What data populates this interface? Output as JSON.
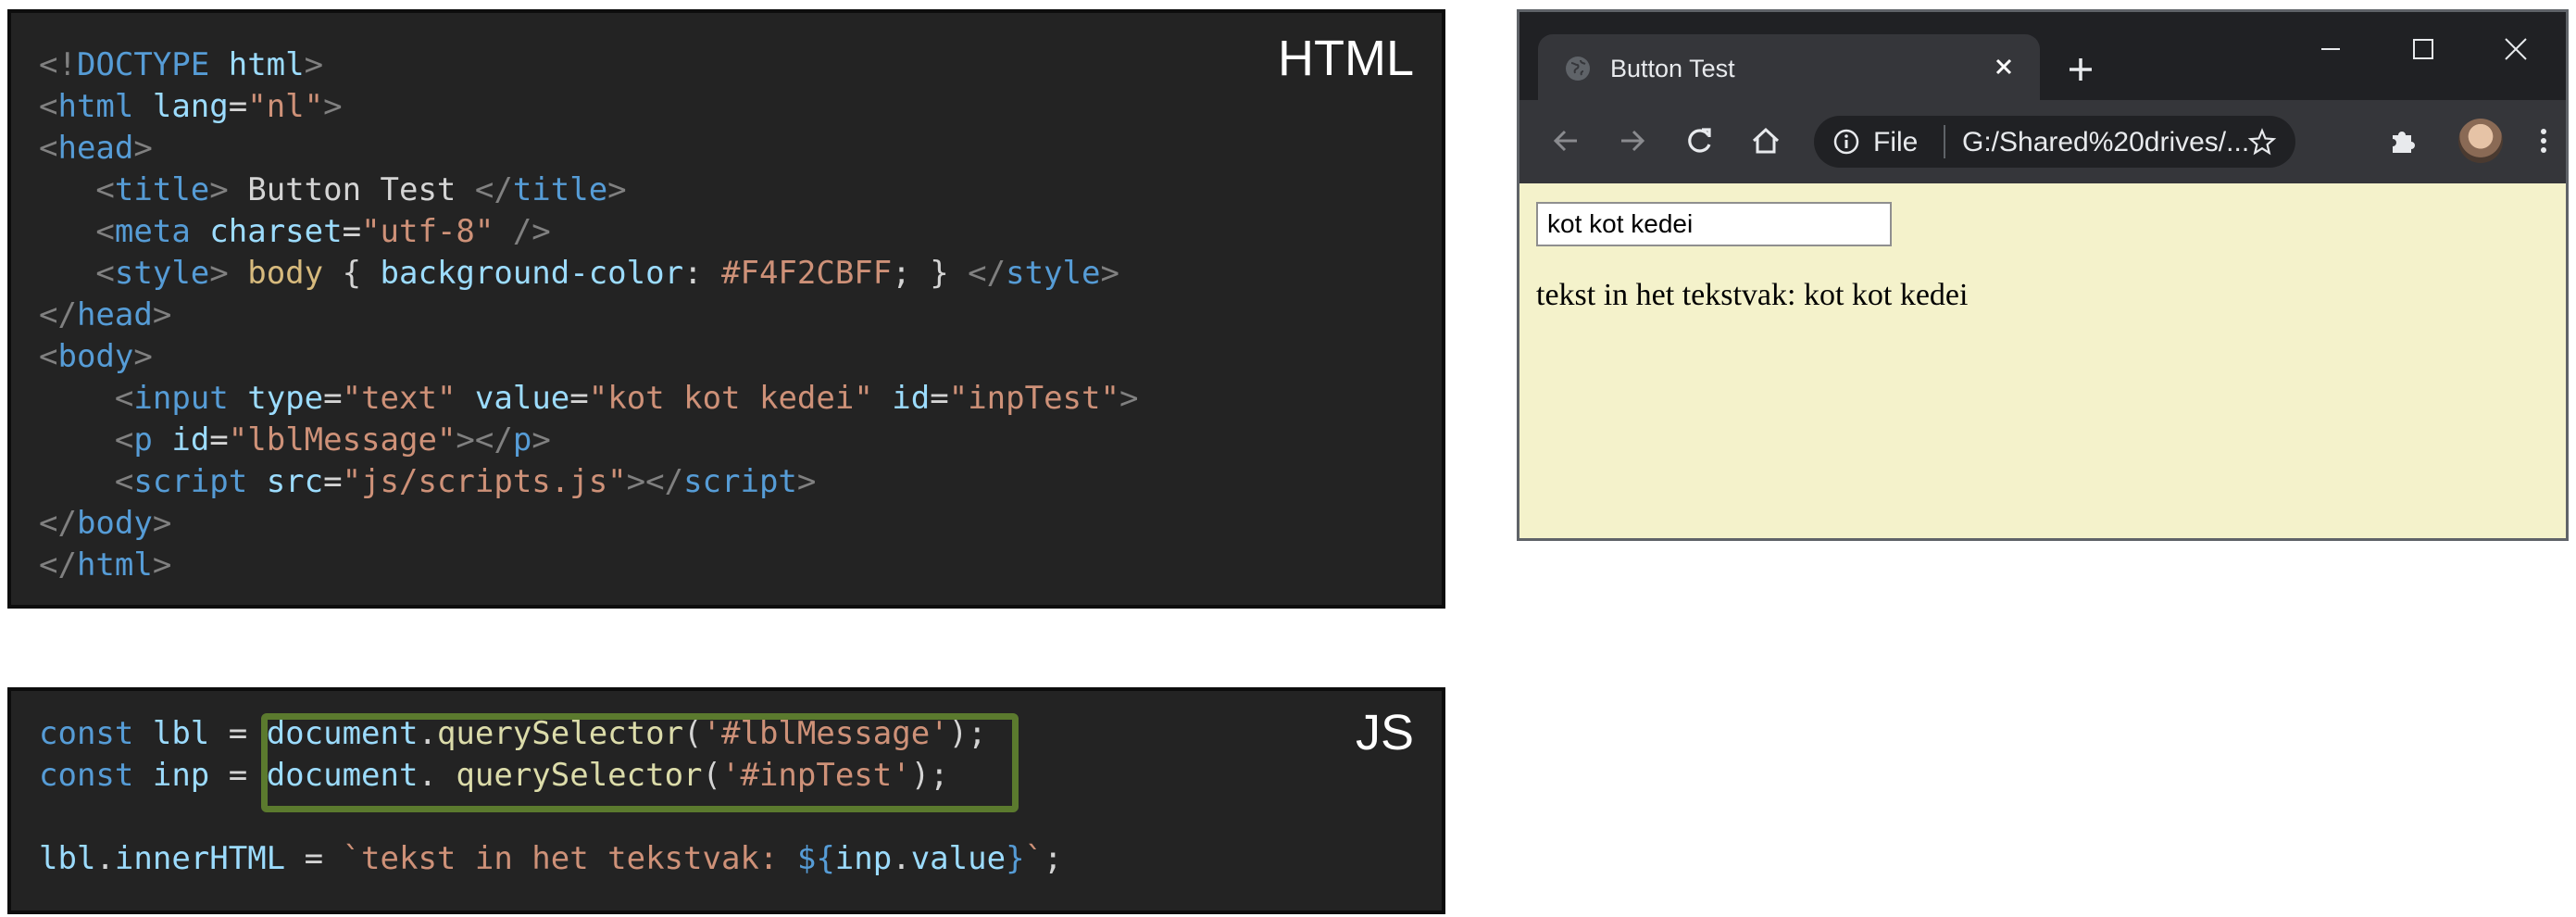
{
  "html_panel": {
    "label": "HTML",
    "lines": [
      [
        "<!",
        "DOCTYPE",
        " ",
        "html",
        ">"
      ],
      [
        "<",
        "html",
        " ",
        "lang",
        "=",
        "\"nl\"",
        ">"
      ],
      [
        "<",
        "head",
        ">"
      ],
      [
        "   ",
        "<",
        "title",
        ">",
        " Button Test ",
        "</",
        "title",
        ">"
      ],
      [
        "   ",
        "<",
        "meta",
        " ",
        "charset",
        "=",
        "\"utf-8\"",
        " />"
      ],
      [
        "   ",
        "<",
        "style",
        ">",
        " ",
        "body",
        " { ",
        "background-color",
        ": ",
        "#F4F2CBFF",
        "; } ",
        "</",
        "style",
        ">"
      ],
      [
        "</",
        "head",
        ">"
      ],
      [
        "<",
        "body",
        ">"
      ],
      [
        "    ",
        "<",
        "input",
        " ",
        "type",
        "=",
        "\"text\"",
        " ",
        "value",
        "=",
        "\"kot kot kedei\"",
        " ",
        "id",
        "=",
        "\"inpTest\"",
        ">"
      ],
      [
        "    ",
        "<",
        "p",
        " ",
        "id",
        "=",
        "\"lblMessage\"",
        "></",
        "p",
        ">"
      ],
      [
        "    ",
        "<",
        "script",
        " ",
        "src",
        "=",
        "\"js/scripts.js\"",
        "></",
        "script",
        ">"
      ],
      [
        "</",
        "body",
        ">"
      ],
      [
        "</",
        "html",
        ">"
      ]
    ],
    "classes": [
      [
        "punct",
        "tag",
        "txt",
        "attr",
        "punct"
      ],
      [
        "punct",
        "tag",
        "txt",
        "attr",
        "txt",
        "str",
        "punct"
      ],
      [
        "punct",
        "tag",
        "punct"
      ],
      [
        "txt",
        "punct",
        "tag",
        "punct",
        "txt",
        "punct",
        "tag",
        "punct"
      ],
      [
        "txt",
        "punct",
        "tag",
        "txt",
        "attr",
        "txt",
        "str",
        "punct"
      ],
      [
        "txt",
        "punct",
        "tag",
        "punct",
        "txt",
        "sel",
        "txt",
        "prop",
        "txt",
        "str",
        "txt",
        "punct",
        "tag",
        "punct"
      ],
      [
        "punct",
        "tag",
        "punct"
      ],
      [
        "punct",
        "tag",
        "punct"
      ],
      [
        "txt",
        "punct",
        "tag",
        "txt",
        "attr",
        "txt",
        "str",
        "txt",
        "attr",
        "txt",
        "str",
        "txt",
        "attr",
        "txt",
        "str",
        "punct"
      ],
      [
        "txt",
        "punct",
        "tag",
        "txt",
        "attr",
        "txt",
        "str",
        "punct",
        "tag",
        "punct"
      ],
      [
        "txt",
        "punct",
        "tag",
        "txt",
        "attr",
        "txt",
        "str",
        "punct",
        "tag",
        "punct"
      ],
      [
        "punct",
        "tag",
        "punct"
      ],
      [
        "punct",
        "tag",
        "punct"
      ]
    ]
  },
  "js_panel": {
    "label": "JS",
    "lines": [
      [
        "const",
        " ",
        "lbl",
        " = ",
        "document",
        ".",
        "querySelector",
        "(",
        "'#lblMessage'",
        ");"
      ],
      [
        "const",
        " ",
        "inp",
        " = ",
        "document",
        ". ",
        "querySelector",
        "(",
        "'#inpTest'",
        ");"
      ],
      [
        ""
      ],
      [
        "lbl",
        ".",
        "innerHTML",
        " = ",
        "`tekst in het tekstvak: ",
        "${",
        "inp",
        ".",
        "value",
        "}",
        "`",
        ";"
      ]
    ],
    "classes": [
      [
        "kw",
        "txt",
        "prop",
        "op",
        "prop",
        "op",
        "fn",
        "op",
        "str",
        "op"
      ],
      [
        "kw",
        "txt",
        "prop",
        "op",
        "prop",
        "op",
        "fn",
        "op",
        "str",
        "op"
      ],
      [
        "txt"
      ],
      [
        "prop",
        "op",
        "prop",
        "op",
        "str",
        "kw",
        "prop",
        "op",
        "prop",
        "kw",
        "str",
        "op"
      ]
    ],
    "highlight_color": "#5b7a2e"
  },
  "browser": {
    "tab_title": "Button Test",
    "omnibox_file_label": "File",
    "omnibox_url": "G:/Shared%20drives/...",
    "page_background": "#F4F2CB",
    "input_value": "kot kot kedei",
    "message": "tekst in het tekstvak: kot kot kedei",
    "icons": [
      "globe-icon",
      "close-icon",
      "plus-icon",
      "minimize-icon",
      "maximize-icon",
      "window-close-icon",
      "back-icon",
      "forward-icon",
      "reload-icon",
      "home-icon",
      "info-icon",
      "star-icon",
      "extensions-icon",
      "avatar",
      "menu-icon"
    ]
  }
}
